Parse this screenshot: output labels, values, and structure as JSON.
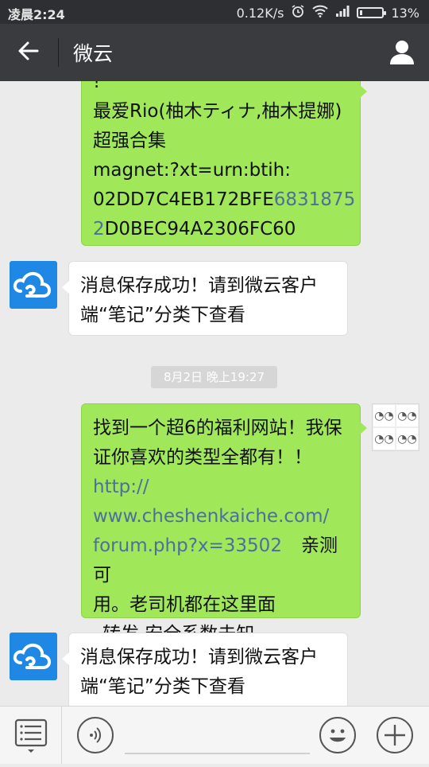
{
  "status_bar": {
    "time": "凌晨2:24",
    "network_speed": "0.12K/s",
    "battery_percent": "13%",
    "battery_level": 0.13
  },
  "title_bar": {
    "title": "微云"
  },
  "messages": [
    {
      "id": "sent-magnet",
      "line0": "!",
      "line1": "最爱Rio(柚木ティナ,柚木提娜)",
      "line2": "超强合集",
      "line3": "magnet:?xt=urn:btih:",
      "line4_a": "02DD7C4EB172BFE",
      "line4_b": "6831875",
      "line5_a": "2",
      "line5_b": "D0BEC94A2306FC60"
    },
    {
      "id": "reply-1",
      "line1": "消息保存成功！请到微云客户",
      "line2": "端“笔记”分类下查看"
    },
    {
      "id": "sent-link",
      "line1": "找到一个超6的福利网站！我保",
      "line2": "证你喜欢的类型全都有！！",
      "link1": "http://",
      "link2": "www.cheshenkaiche.com/",
      "link3": "forum.php?x=33502",
      "line3_tail": "亲测可",
      "line4": "用。老司机都在这里面",
      "line5": "转发 安全系数未知"
    },
    {
      "id": "reply-2",
      "line1": "消息保存成功！请到微云客户",
      "line2": "端“笔记”分类下查看"
    }
  ],
  "timestamp": "8月2日 晚上19:27",
  "colors": {
    "sent_bubble": "#a0e75a",
    "received_bubble": "#ffffff",
    "title_bar": "#3a3b3f",
    "link": "#4c6f9e",
    "avatar": "#1f88e5"
  },
  "icons": {
    "back": "arrow-left-icon",
    "profile": "person-icon",
    "menu": "list-menu-icon",
    "voice": "voice-icon",
    "emoji": "smiley-icon",
    "add": "plus-icon"
  }
}
